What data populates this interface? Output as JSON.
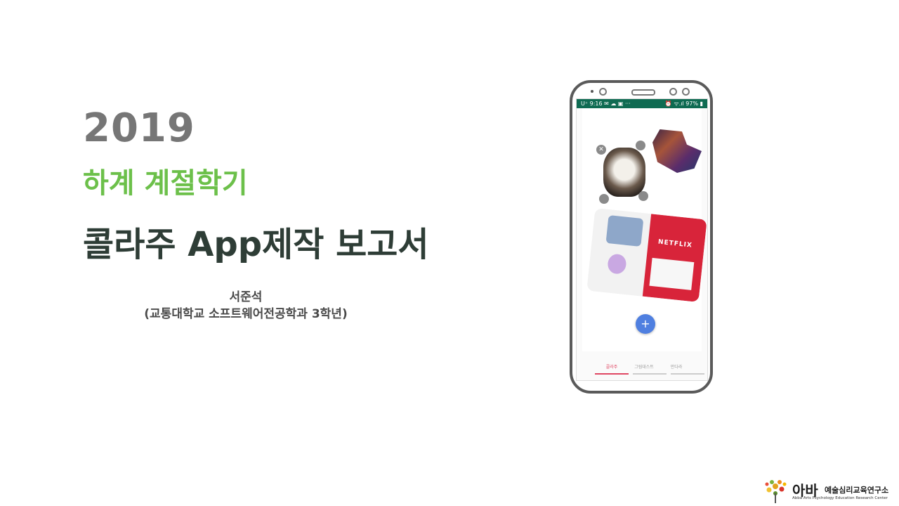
{
  "slide": {
    "year": "2019",
    "semester": "하계 계절학기",
    "title": "콜라주 App제작 보고서",
    "author": "서준석",
    "affiliation": "(교통대학교 소프트웨어전공학과 3학년)"
  },
  "phone": {
    "status_left": "U⁺ 9:16 ✉ ☁ ▣  ···",
    "status_right": "⏰ ᯤ.ıl 97% ▮",
    "fab_label": "+",
    "tabs": [
      "콜라주",
      "그림대스트",
      "만다라"
    ],
    "sticker_text": "NETFLIX"
  },
  "logo": {
    "name": "아바",
    "subtitle": "예술심리교육연구소",
    "english": "Abba Arts Psychology Education Research Center"
  },
  "colors": {
    "accent_green": "#6cc04a",
    "title_dark": "#2e3d36",
    "status_bar": "#0f6b52",
    "fab_blue": "#4f7fe0",
    "tab_active": "#e04763"
  }
}
